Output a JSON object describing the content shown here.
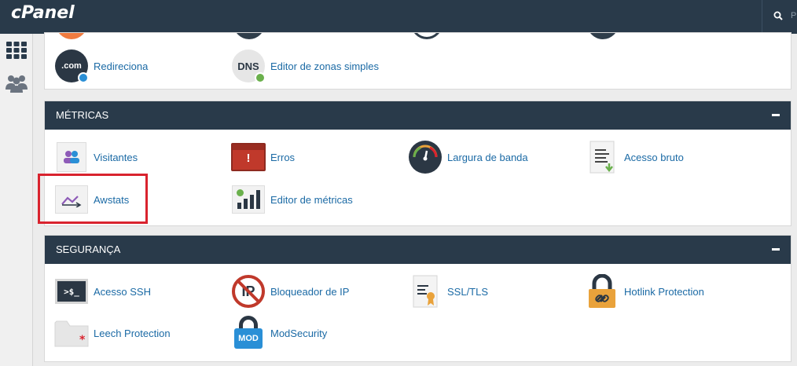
{
  "topbar": {
    "logo": "cPanel",
    "search_hint": "P"
  },
  "sidebar": {
    "items": [
      {
        "icon": "grid-icon"
      },
      {
        "icon": "users-icon"
      }
    ]
  },
  "top_panel": {
    "items": [
      {
        "label": "Redireciona",
        "icon_text": ".com"
      },
      {
        "label": "Editor de zonas simples",
        "icon_text": "DNS"
      }
    ]
  },
  "metrics": {
    "title": "MÉTRICAS",
    "items": [
      {
        "label": "Visitantes"
      },
      {
        "label": "Erros",
        "icon_text": "!"
      },
      {
        "label": "Largura de banda"
      },
      {
        "label": "Acesso bruto"
      },
      {
        "label": "Awstats"
      },
      {
        "label": "Editor de métricas"
      }
    ]
  },
  "security": {
    "title": "SEGURANÇA",
    "items": [
      {
        "label": "Acesso SSH",
        "icon_text": ">$_"
      },
      {
        "label": "Bloqueador de IP",
        "icon_text": "IP"
      },
      {
        "label": "SSL/TLS"
      },
      {
        "label": "Hotlink Protection"
      },
      {
        "label": "Leech Protection"
      },
      {
        "label": "ModSecurity",
        "icon_text": "MOD"
      }
    ]
  },
  "colors": {
    "header": "#293a4a",
    "link": "#1b6aa5",
    "highlight": "#d9232e"
  }
}
